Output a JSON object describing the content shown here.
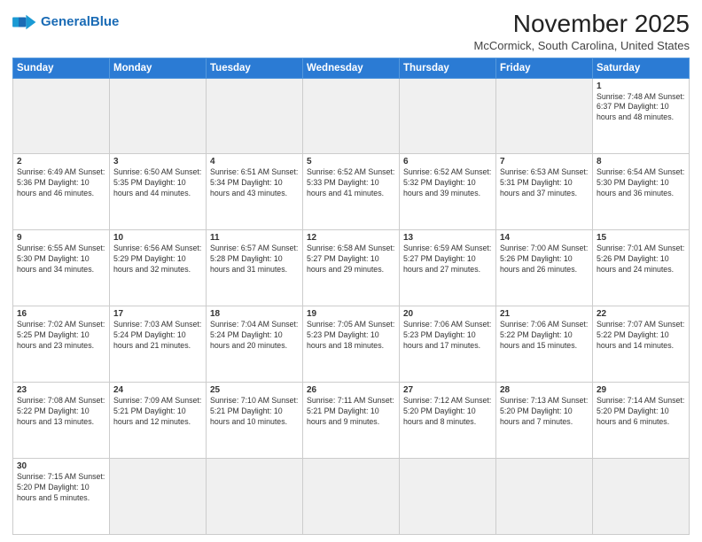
{
  "header": {
    "logo_general": "General",
    "logo_blue": "Blue",
    "month_year": "November 2025",
    "location": "McCormick, South Carolina, United States"
  },
  "weekdays": [
    "Sunday",
    "Monday",
    "Tuesday",
    "Wednesday",
    "Thursday",
    "Friday",
    "Saturday"
  ],
  "weeks": [
    [
      {
        "day": "",
        "info": ""
      },
      {
        "day": "",
        "info": ""
      },
      {
        "day": "",
        "info": ""
      },
      {
        "day": "",
        "info": ""
      },
      {
        "day": "",
        "info": ""
      },
      {
        "day": "",
        "info": ""
      },
      {
        "day": "1",
        "info": "Sunrise: 7:48 AM\nSunset: 6:37 PM\nDaylight: 10 hours\nand 48 minutes."
      }
    ],
    [
      {
        "day": "2",
        "info": "Sunrise: 6:49 AM\nSunset: 5:36 PM\nDaylight: 10 hours\nand 46 minutes."
      },
      {
        "day": "3",
        "info": "Sunrise: 6:50 AM\nSunset: 5:35 PM\nDaylight: 10 hours\nand 44 minutes."
      },
      {
        "day": "4",
        "info": "Sunrise: 6:51 AM\nSunset: 5:34 PM\nDaylight: 10 hours\nand 43 minutes."
      },
      {
        "day": "5",
        "info": "Sunrise: 6:52 AM\nSunset: 5:33 PM\nDaylight: 10 hours\nand 41 minutes."
      },
      {
        "day": "6",
        "info": "Sunrise: 6:52 AM\nSunset: 5:32 PM\nDaylight: 10 hours\nand 39 minutes."
      },
      {
        "day": "7",
        "info": "Sunrise: 6:53 AM\nSunset: 5:31 PM\nDaylight: 10 hours\nand 37 minutes."
      },
      {
        "day": "8",
        "info": "Sunrise: 6:54 AM\nSunset: 5:30 PM\nDaylight: 10 hours\nand 36 minutes."
      }
    ],
    [
      {
        "day": "9",
        "info": "Sunrise: 6:55 AM\nSunset: 5:30 PM\nDaylight: 10 hours\nand 34 minutes."
      },
      {
        "day": "10",
        "info": "Sunrise: 6:56 AM\nSunset: 5:29 PM\nDaylight: 10 hours\nand 32 minutes."
      },
      {
        "day": "11",
        "info": "Sunrise: 6:57 AM\nSunset: 5:28 PM\nDaylight: 10 hours\nand 31 minutes."
      },
      {
        "day": "12",
        "info": "Sunrise: 6:58 AM\nSunset: 5:27 PM\nDaylight: 10 hours\nand 29 minutes."
      },
      {
        "day": "13",
        "info": "Sunrise: 6:59 AM\nSunset: 5:27 PM\nDaylight: 10 hours\nand 27 minutes."
      },
      {
        "day": "14",
        "info": "Sunrise: 7:00 AM\nSunset: 5:26 PM\nDaylight: 10 hours\nand 26 minutes."
      },
      {
        "day": "15",
        "info": "Sunrise: 7:01 AM\nSunset: 5:26 PM\nDaylight: 10 hours\nand 24 minutes."
      }
    ],
    [
      {
        "day": "16",
        "info": "Sunrise: 7:02 AM\nSunset: 5:25 PM\nDaylight: 10 hours\nand 23 minutes."
      },
      {
        "day": "17",
        "info": "Sunrise: 7:03 AM\nSunset: 5:24 PM\nDaylight: 10 hours\nand 21 minutes."
      },
      {
        "day": "18",
        "info": "Sunrise: 7:04 AM\nSunset: 5:24 PM\nDaylight: 10 hours\nand 20 minutes."
      },
      {
        "day": "19",
        "info": "Sunrise: 7:05 AM\nSunset: 5:23 PM\nDaylight: 10 hours\nand 18 minutes."
      },
      {
        "day": "20",
        "info": "Sunrise: 7:06 AM\nSunset: 5:23 PM\nDaylight: 10 hours\nand 17 minutes."
      },
      {
        "day": "21",
        "info": "Sunrise: 7:06 AM\nSunset: 5:22 PM\nDaylight: 10 hours\nand 15 minutes."
      },
      {
        "day": "22",
        "info": "Sunrise: 7:07 AM\nSunset: 5:22 PM\nDaylight: 10 hours\nand 14 minutes."
      }
    ],
    [
      {
        "day": "23",
        "info": "Sunrise: 7:08 AM\nSunset: 5:22 PM\nDaylight: 10 hours\nand 13 minutes."
      },
      {
        "day": "24",
        "info": "Sunrise: 7:09 AM\nSunset: 5:21 PM\nDaylight: 10 hours\nand 12 minutes."
      },
      {
        "day": "25",
        "info": "Sunrise: 7:10 AM\nSunset: 5:21 PM\nDaylight: 10 hours\nand 10 minutes."
      },
      {
        "day": "26",
        "info": "Sunrise: 7:11 AM\nSunset: 5:21 PM\nDaylight: 10 hours\nand 9 minutes."
      },
      {
        "day": "27",
        "info": "Sunrise: 7:12 AM\nSunset: 5:20 PM\nDaylight: 10 hours\nand 8 minutes."
      },
      {
        "day": "28",
        "info": "Sunrise: 7:13 AM\nSunset: 5:20 PM\nDaylight: 10 hours\nand 7 minutes."
      },
      {
        "day": "29",
        "info": "Sunrise: 7:14 AM\nSunset: 5:20 PM\nDaylight: 10 hours\nand 6 minutes."
      }
    ],
    [
      {
        "day": "30",
        "info": "Sunrise: 7:15 AM\nSunset: 5:20 PM\nDaylight: 10 hours\nand 5 minutes."
      },
      {
        "day": "",
        "info": ""
      },
      {
        "day": "",
        "info": ""
      },
      {
        "day": "",
        "info": ""
      },
      {
        "day": "",
        "info": ""
      },
      {
        "day": "",
        "info": ""
      },
      {
        "day": "",
        "info": ""
      }
    ]
  ]
}
